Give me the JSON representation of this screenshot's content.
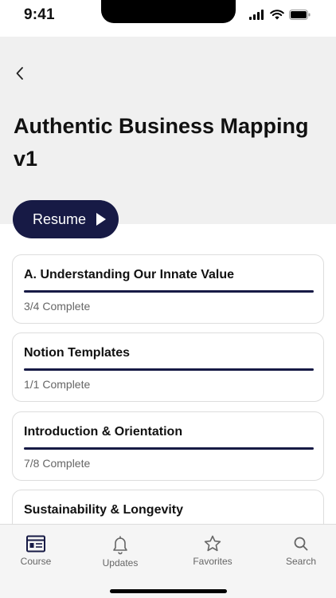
{
  "status_bar": {
    "time": "9:41"
  },
  "header": {
    "back_icon": "chevron-left-icon",
    "title": "Authentic Business Mapping v1",
    "resume_label": "Resume",
    "resume_icon": "play-icon",
    "accent_color": "#171a45",
    "background_color": "#f0f0f0"
  },
  "modules": [
    {
      "title": "A. Understanding Our Innate Value",
      "status": "3/4 Complete",
      "progress": 1.0
    },
    {
      "title": "Notion Templates",
      "status": "1/1 Complete",
      "progress": 1.0
    },
    {
      "title": "Introduction & Orientation",
      "status": "7/8 Complete",
      "progress": 1.0
    },
    {
      "title": "Sustainability & Longevity",
      "status": "",
      "progress": 0
    }
  ],
  "tab_bar": {
    "tabs": [
      {
        "label": "Course",
        "icon": "course-icon",
        "active": true
      },
      {
        "label": "Updates",
        "icon": "bell-icon",
        "active": false
      },
      {
        "label": "Favorites",
        "icon": "star-icon",
        "active": false
      },
      {
        "label": "Search",
        "icon": "search-icon",
        "active": false
      }
    ]
  }
}
